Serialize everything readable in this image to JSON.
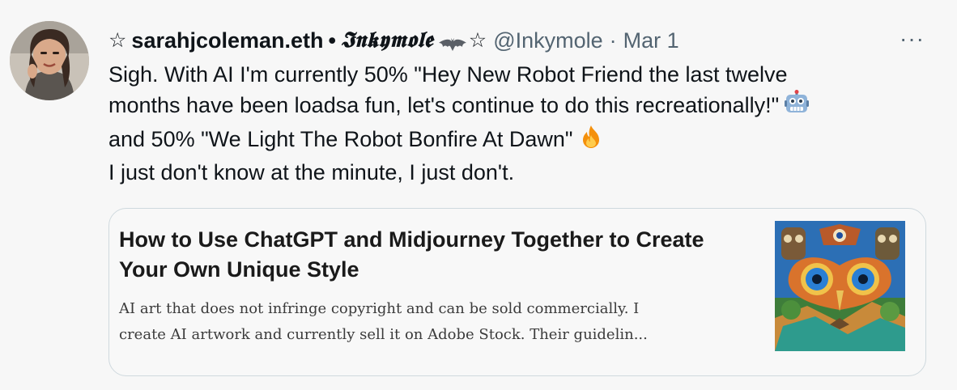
{
  "tweet": {
    "star_prefix": "☆",
    "display_name": "sarahjcoleman.eth",
    "separator_bullet": "•",
    "fraktur_name": "𝕴𝖓𝖐𝖞𝖒𝖔𝖑𝖊",
    "star_suffix": "☆",
    "handle": "@Inkymole",
    "dot": "·",
    "date": "Mar 1",
    "more_label": "···",
    "body_lines": [
      "Sigh. With AI I'm currently 50% \"Hey New Robot Friend the last twelve",
      "months have been loadsa fun, let's continue to do this recreationally!\"",
      "and 50% \"We Light The Robot Bonfire At Dawn\"",
      "I just don't know at the minute, I just don't."
    ],
    "emoji_icons": [
      "robot-icon",
      "fire-icon"
    ]
  },
  "card": {
    "title": "How to Use ChatGPT and Midjourney Together to Create Your Own Unique Style",
    "desc_lines": [
      "AI art that does not infringe copyright and can be sold commercially. I",
      "create AI artwork and currently sell it on Adobe Stock. Their guidelin..."
    ]
  }
}
